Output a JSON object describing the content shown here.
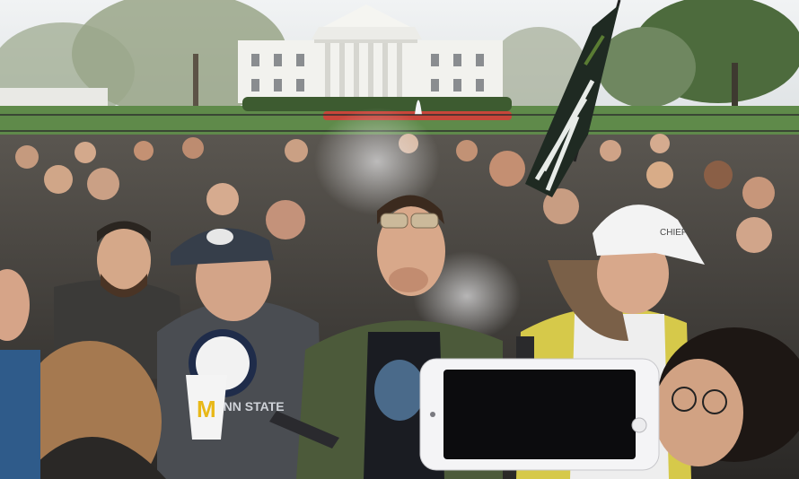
{
  "photo": {
    "scene": "crowd-at-white-house-lawn",
    "caps": [
      {
        "text": "CHIEF"
      },
      {
        "text": "PENN STATE"
      }
    ],
    "colors": {
      "sky": "#e9ecee",
      "lawn": "#5f8a4a",
      "building": "#f2f2ee",
      "flag_dark": "#1f2a22",
      "phone_white": "#f4f4f6",
      "phone_screen": "#0c0c0e"
    }
  }
}
